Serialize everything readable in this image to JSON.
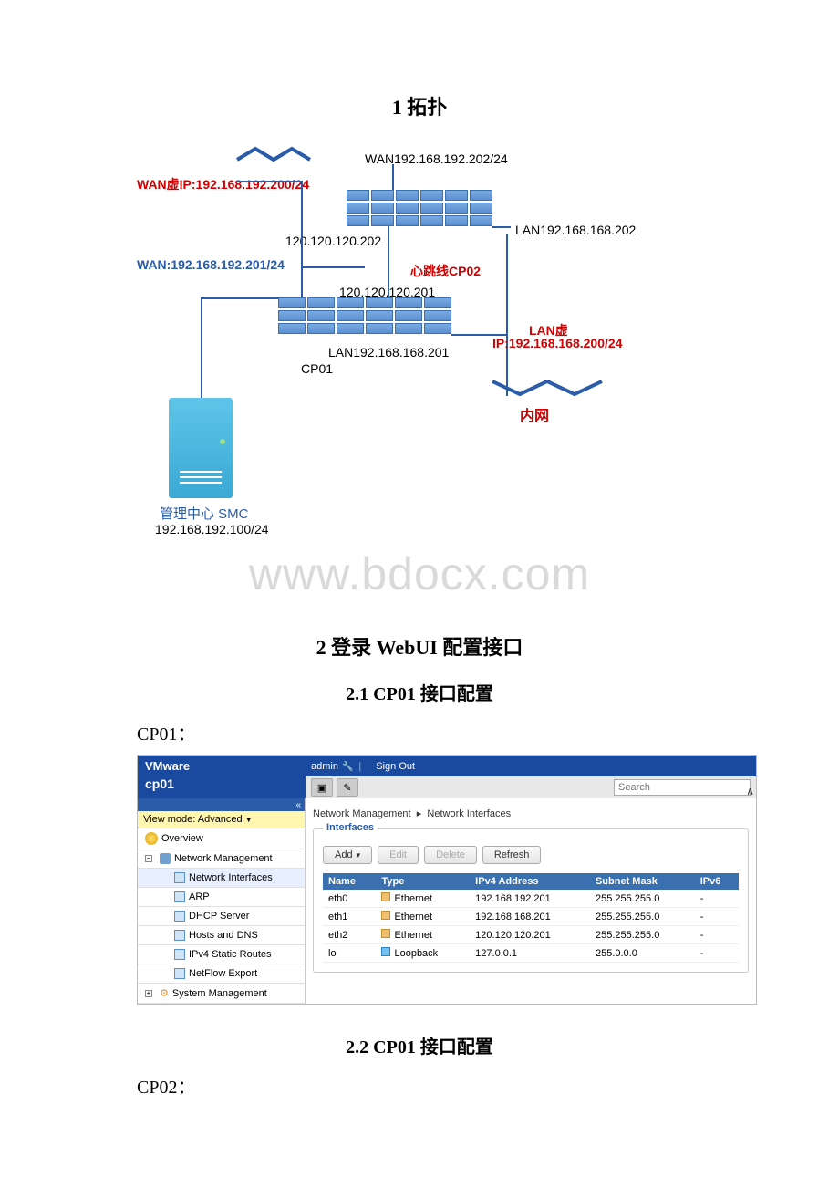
{
  "sections": {
    "h1_topology": "1 拓扑",
    "h1_webui": "2 登录 WebUI 配置接口",
    "h2_cp01": "2.1 CP01 接口配置",
    "h2_cp02": "2.2 CP01 接口配置",
    "label_cp01": "CP01：",
    "label_cp02": "CP02："
  },
  "watermark": "www.bdocx.com",
  "topology": {
    "wan_virtual": "WAN虚IP:192.168.192.200/24",
    "wan_top": "WAN192.168.192.202/24",
    "hb1": "120.120.120.202",
    "lan_top": "LAN192.168.168.202",
    "wan_mid": "WAN:192.168.192.201/24",
    "heartbeat_label": "心跳线CP02",
    "hb2": "120.120.120.201",
    "lan_virtual_1": "LAN虚",
    "lan_virtual_2": "IP:192.168.168.200/24",
    "lan_mid": "LAN192.168.168.201",
    "cp01_label": "CP01",
    "inner_net": "内网",
    "smc_label": "管理中心 SMC",
    "smc_ip": "192.168.192.100/24"
  },
  "webui": {
    "brand": "VMware",
    "user": "admin",
    "signout": "Sign Out",
    "device": "cp01",
    "search_placeholder": "Search",
    "viewmode_label": "View mode:",
    "viewmode_value": "Advanced",
    "nav": {
      "overview": "Overview",
      "netmgmt": "Network Management",
      "ifaces": "Network Interfaces",
      "arp": "ARP",
      "dhcp": "DHCP Server",
      "hosts": "Hosts and DNS",
      "static": "IPv4 Static Routes",
      "netflow": "NetFlow Export",
      "sysmgmt": "System Management"
    },
    "breadcrumb": {
      "a": "Network Management",
      "sep": "▸",
      "b": "Network Interfaces"
    },
    "fieldset_title": "Interfaces",
    "buttons": {
      "add": "Add",
      "edit": "Edit",
      "delete": "Delete",
      "refresh": "Refresh"
    },
    "columns": [
      "Name",
      "Type",
      "IPv4 Address",
      "Subnet Mask",
      "IPv6"
    ],
    "rows": [
      {
        "name": "eth0",
        "type": "Ethernet",
        "ip": "192.168.192.201",
        "mask": "255.255.255.0",
        "ipv6": "-",
        "icon": "eth"
      },
      {
        "name": "eth1",
        "type": "Ethernet",
        "ip": "192.168.168.201",
        "mask": "255.255.255.0",
        "ipv6": "-",
        "icon": "eth"
      },
      {
        "name": "eth2",
        "type": "Ethernet",
        "ip": "120.120.120.201",
        "mask": "255.255.255.0",
        "ipv6": "-",
        "icon": "eth"
      },
      {
        "name": "lo",
        "type": "Loopback",
        "ip": "127.0.0.1",
        "mask": "255.0.0.0",
        "ipv6": "-",
        "icon": "lo"
      }
    ]
  }
}
